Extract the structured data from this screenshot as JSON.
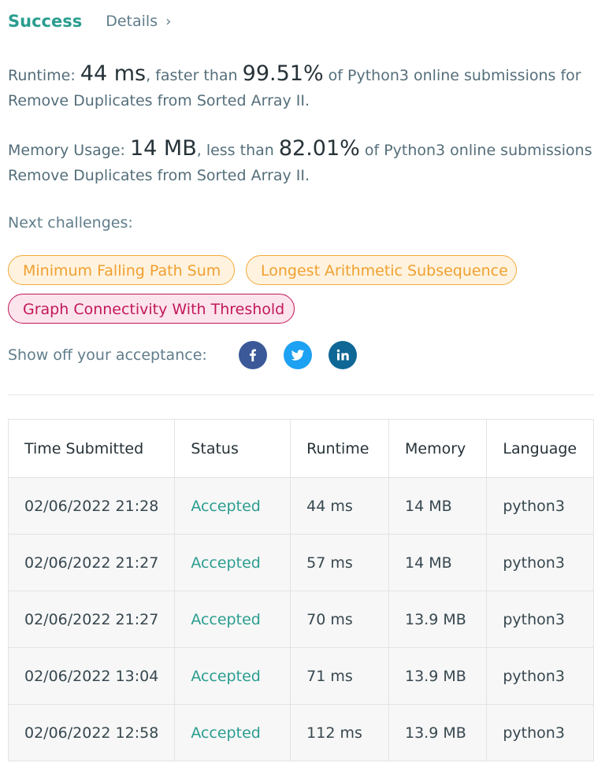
{
  "header": {
    "status": "Success",
    "details_label": "Details",
    "chevron": "›"
  },
  "runtime": {
    "label": "Runtime:",
    "value": "44 ms",
    "comparison": ", faster than",
    "percent": "99.51%",
    "suffix": "of Python3 online submissions for",
    "problem": "Remove Duplicates from Sorted Array II."
  },
  "memory": {
    "label": "Memory Usage:",
    "value": "14 MB",
    "comparison": ", less than",
    "percent": "82.01%",
    "suffix": "of Python3 online submissions for",
    "problem": "Remove Duplicates from Sorted Array II."
  },
  "next": {
    "label": "Next challenges:",
    "challenges": [
      {
        "title": "Minimum Falling Path Sum",
        "difficulty": "medium"
      },
      {
        "title": "Longest Arithmetic Subsequence",
        "difficulty": "medium"
      },
      {
        "title": "Graph Connectivity With Threshold",
        "difficulty": "hard"
      }
    ]
  },
  "share": {
    "label": "Show off your acceptance:",
    "icons": [
      {
        "name": "facebook-icon",
        "glyph": "f",
        "color": "#3b5998"
      },
      {
        "name": "twitter-icon",
        "glyph": "bird",
        "color": "#1da1f2"
      },
      {
        "name": "linkedin-icon",
        "glyph": "in",
        "color": "#0e6795"
      }
    ]
  },
  "table": {
    "headers": [
      "Time Submitted",
      "Status",
      "Runtime",
      "Memory",
      "Language"
    ],
    "rows": [
      [
        "02/06/2022 21:28",
        "Accepted",
        "44 ms",
        "14 MB",
        "python3"
      ],
      [
        "02/06/2022 21:27",
        "Accepted",
        "57 ms",
        "14 MB",
        "python3"
      ],
      [
        "02/06/2022 21:27",
        "Accepted",
        "70 ms",
        "13.9 MB",
        "python3"
      ],
      [
        "02/06/2022 13:04",
        "Accepted",
        "71 ms",
        "13.9 MB",
        "python3"
      ],
      [
        "02/06/2022 12:58",
        "Accepted",
        "112 ms",
        "13.9 MB",
        "python3"
      ]
    ]
  },
  "colors": {
    "accent": "#2a9d8f",
    "medium": "#f0a030",
    "hard": "#c2185b"
  }
}
